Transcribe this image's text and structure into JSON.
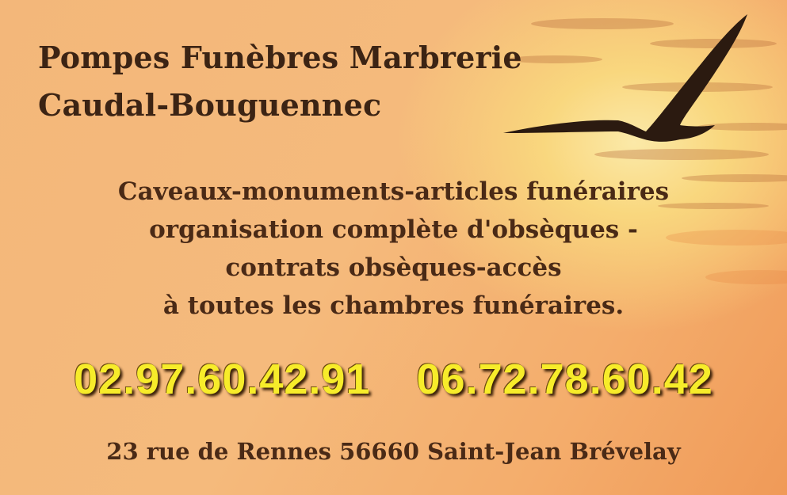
{
  "business": {
    "name_line1": "Pompes Funèbres Marbrerie",
    "name_line2": "Caudal-Bouguennec"
  },
  "services": [
    "Caveaux-monuments-articles funéraires",
    "organisation complète d'obsèques -",
    "contrats obsèques-accès",
    "à toutes les chambres funéraires."
  ],
  "phones": [
    "02.97.60.42.91",
    "06.72.78.60.42"
  ],
  "address": "23 rue de Rennes 56660 Saint-Jean Brévelay",
  "colors": {
    "background": "#f4b577",
    "sun": "#fbe9a8",
    "text": "#4a2a16",
    "phone": "#f7ec2a"
  },
  "graphics": {
    "bird": "seagull-silhouette-icon"
  }
}
